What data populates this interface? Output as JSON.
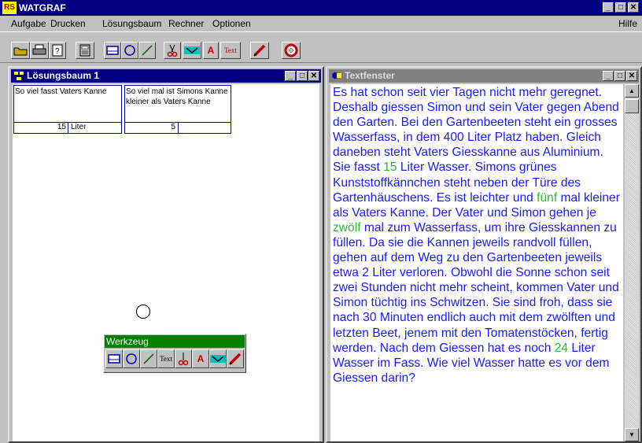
{
  "app": {
    "logo": "RS",
    "title": "WATGRAF"
  },
  "window_buttons": {
    "minimize": "_",
    "maximize": "□",
    "close": "✕"
  },
  "menu": {
    "items": [
      "Aufgabe",
      "Drucken",
      "Lösungsbaum",
      "Rechner",
      "Optionen"
    ],
    "help": "Hilfe"
  },
  "toolbar": {
    "icons": [
      "open-folder-icon",
      "print-icon",
      "help-icon",
      "calculator-icon",
      "box-tool-icon",
      "circle-tool-icon",
      "line-tool-icon",
      "cut-tool-icon",
      "connect-tool-icon",
      "font-tool-icon",
      "text-tool-icon",
      "pen-tool-icon",
      "lifebuoy-icon"
    ],
    "text_button": "Text",
    "font_button": "A"
  },
  "tree_window": {
    "title": "Lösungsbaum 1",
    "nodes": [
      {
        "text": "So viel fasst Vaters Kanne",
        "value": "15",
        "unit": "Liter"
      },
      {
        "text": "So viel mal ist Simons Kanne kleiner als Vaters Kanne",
        "value": "5",
        "unit": ""
      }
    ]
  },
  "palette": {
    "title": "Werkzeug",
    "text_button": "Text",
    "font_button": "A"
  },
  "text_window": {
    "title": "Textfenster",
    "segments": [
      "Es hat schon seit vier Tagen nicht mehr geregnet. Deshalb giessen Simon und sein Vater gegen Abend den Garten. Bei den Gartenbeeten steht ein grosses Wasserfass, in dem 400 Liter Platz haben. Gleich daneben steht Vaters Giesskanne aus Aluminium. Sie fasst ",
      "15",
      " Liter Wasser. Simons grünes Kunststoffkännchen steht neben der Türe des Gartenhäuschens. Es ist leichter und ",
      "fünf",
      " mal kleiner als Vaters Kanne. Der Vater und Simon gehen je ",
      "zwölf",
      " mal zum Wasserfass, um ihre Giesskannen zu füllen. Da sie die Kannen jeweils randvoll füllen, gehen auf dem Weg zu den Gartenbeeten jeweils etwa 2 Liter verloren. Obwohl die Sonne schon seit zwei Stunden nicht mehr scheint, kommen Vater und Simon tüchtig ins Schwitzen. Sie sind froh, dass sie nach 30 Minuten endlich auch mit dem zwölften und letzten Beet, jenem mit den Tomatenstöcken, fertig werden. Nach dem Giessen hat es noch ",
      "24",
      " Liter Wasser im Fass. Wie viel Wasser hatte es vor dem Giessen darin?"
    ]
  },
  "colors": {
    "titlebar": "#000080",
    "text": "#1a1aff",
    "highlight": "#2db82d",
    "palette_title": "#008000"
  }
}
